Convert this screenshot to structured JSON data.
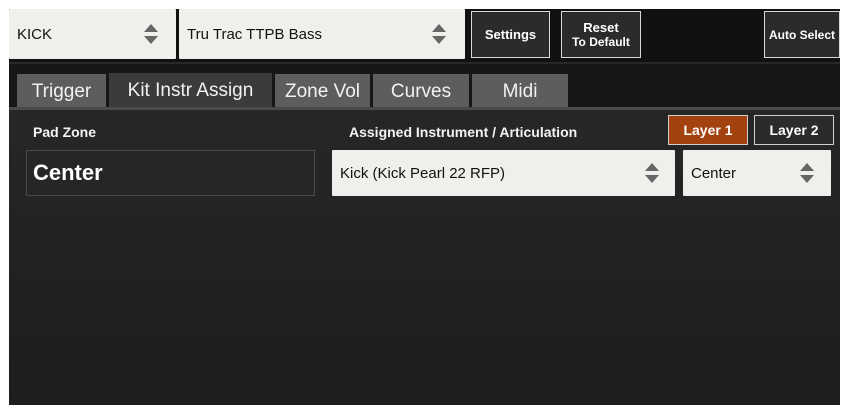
{
  "top": {
    "drum_select": {
      "value": "KICK"
    },
    "kit_select": {
      "value": "Tru Trac TTPB Bass"
    },
    "settings_label": "Settings",
    "reset_line1": "Reset",
    "reset_line2": "To Default",
    "auto_select_label": "Auto Select"
  },
  "tabs": [
    {
      "label": "Trigger"
    },
    {
      "label": "Kit Instr Assign"
    },
    {
      "label": "Zone Vol"
    },
    {
      "label": "Curves"
    },
    {
      "label": "Midi"
    }
  ],
  "active_tab": "Kit Instr Assign",
  "assign": {
    "pad_zone_header": "Pad Zone",
    "instrument_header": "Assigned Instrument / Articulation",
    "layer1_label": "Layer 1",
    "layer2_label": "Layer 2",
    "active_layer": "Layer 1",
    "pad_zone_value": "Center",
    "instrument_value": "Kick (Kick Pearl 22 RFP)",
    "articulation_value": "Center"
  },
  "colors": {
    "accent_orange": "#a3410f",
    "select_bg": "#efefeb",
    "tab_bg": "#5d5d5d",
    "tab_active_bg": "#3b3b3b"
  },
  "icons": {
    "updown": "up-down-arrows-icon"
  }
}
